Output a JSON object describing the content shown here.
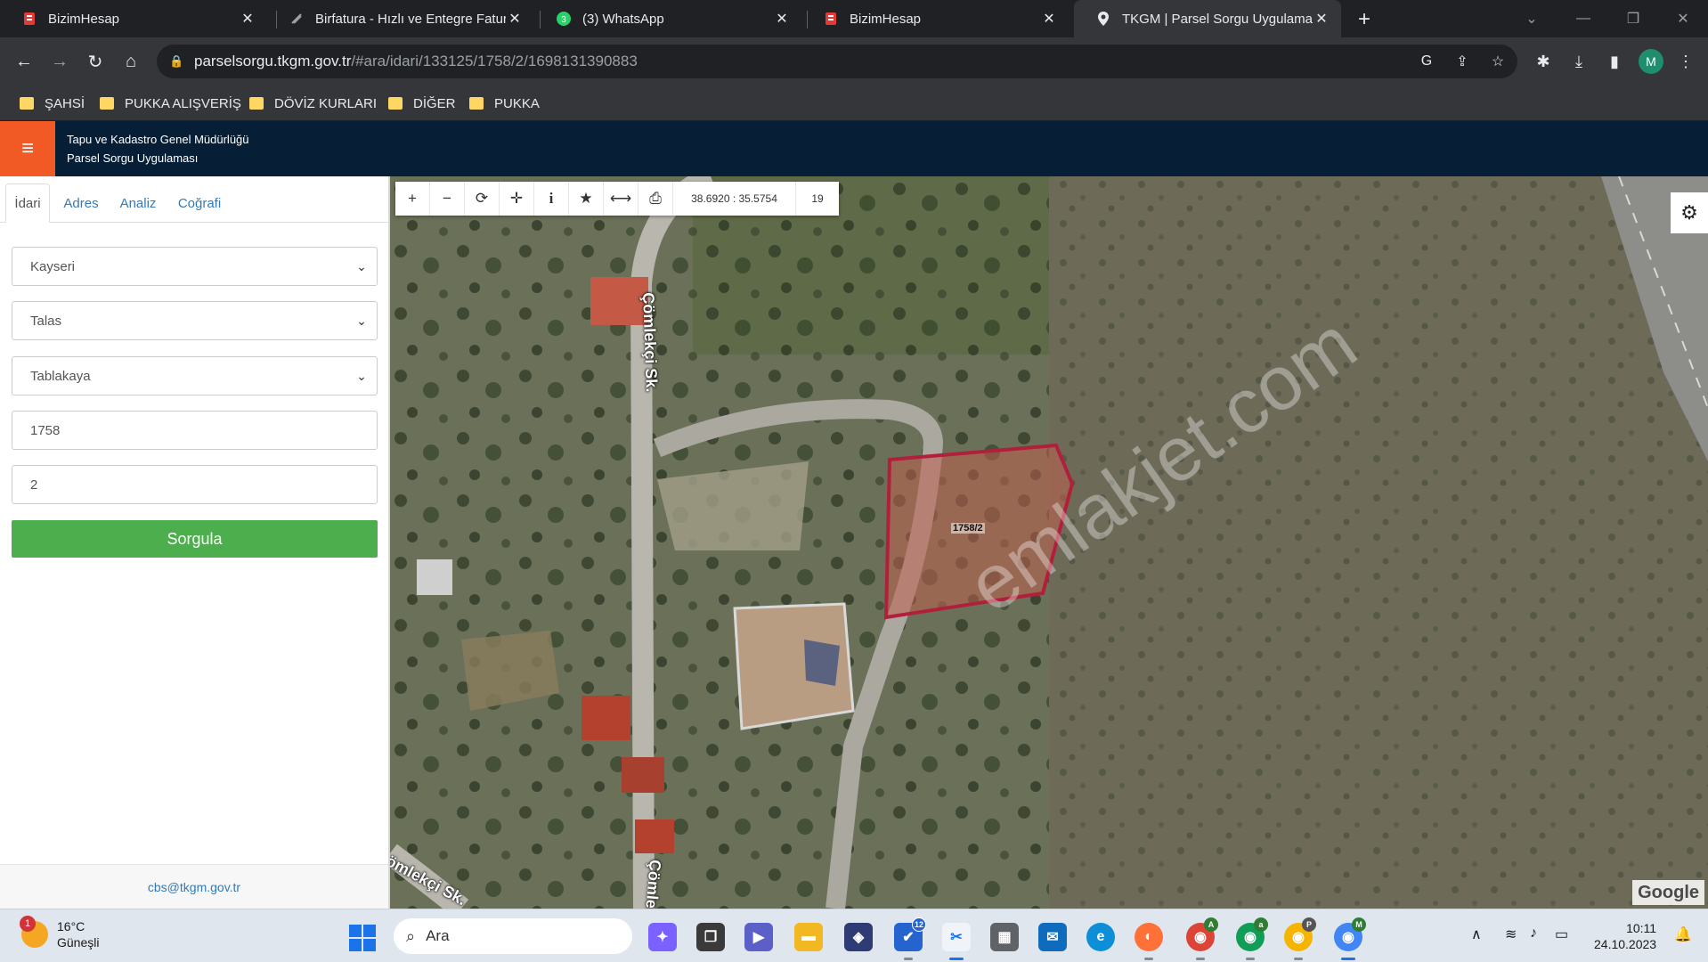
{
  "browser": {
    "tabs": [
      {
        "title": "BizimHesap",
        "icon": "bizimhesap-icon"
      },
      {
        "title": "Birfatura - Hızlı ve Entegre Fatur",
        "icon": "birfatura-icon"
      },
      {
        "title": "(3) WhatsApp",
        "icon": "whatsapp-icon",
        "badge": "3"
      },
      {
        "title": "BizimHesap",
        "icon": "bizimhesap-icon"
      },
      {
        "title": "TKGM | Parsel Sorgu Uygulaması",
        "icon": "map-pin-icon"
      }
    ],
    "active_tab": 4,
    "address": {
      "domain": "parselsorgu.tkgm.gov.tr",
      "path": "/#ara/idari/133125/1758/2/1698131390883"
    },
    "avatar_letter": "M",
    "bookmarks": [
      "ŞAHSİ",
      "PUKKA ALIŞVERİŞ",
      "DÖVİZ KURLARI",
      "DİĞER",
      "PUKKA"
    ]
  },
  "app": {
    "org_line1": "Tapu ve Kadastro Genel Müdürlüğü",
    "org_line2": "Parsel Sorgu Uygulaması",
    "brand_color": "#071f36",
    "accent_color": "#f15a24"
  },
  "sidebar": {
    "tabs": [
      "İdari",
      "Adres",
      "Analiz",
      "Coğrafi"
    ],
    "active_tab": 0,
    "il": "Kayseri",
    "ilce": "Talas",
    "mahalle": "Tablakaya",
    "ada": "1758",
    "parsel": "2",
    "submit_label": "Sorgula",
    "footer_email": "cbs@tkgm.gov.tr"
  },
  "map": {
    "coordinates": "38.6920 : 35.5754",
    "zoom": "19",
    "parcel_label": "1758/2",
    "street_labels": [
      "Çömlekçi Sk.",
      "Çömlekçi Sk.",
      "Çömlekçi Sk."
    ],
    "watermark": "emlakjet.com",
    "attribution": "Google",
    "parcel_color": "#b0203a"
  },
  "taskbar": {
    "weather_temp": "16°C",
    "weather_desc": "Güneşli",
    "weather_badge": "1",
    "search_placeholder": "Ara",
    "todo_badge": "12",
    "time": "10:11",
    "date": "24.10.2023"
  }
}
